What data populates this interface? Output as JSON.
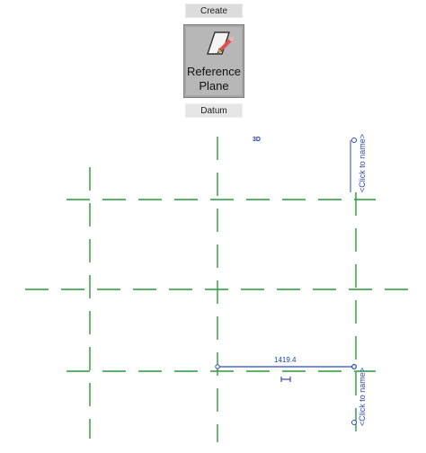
{
  "ribbon": {
    "panel_title": "Create",
    "button_line1": "Reference",
    "button_line2": "Plane",
    "panel_footer": "Datum"
  },
  "canvas": {
    "view_label": "3D",
    "reference_plane_name_placeholder": "<Click to name>",
    "dimension_value": "1419.4"
  },
  "colors": {
    "grid_line": "#2a9a3a",
    "annotation": "#2f49c4",
    "ribbon_button_bg": "#b7b7b7"
  },
  "icons": {
    "reference_plane": "reference-plane-icon",
    "pencil": "pencil-icon",
    "lock": "dimension-lock-icon"
  }
}
